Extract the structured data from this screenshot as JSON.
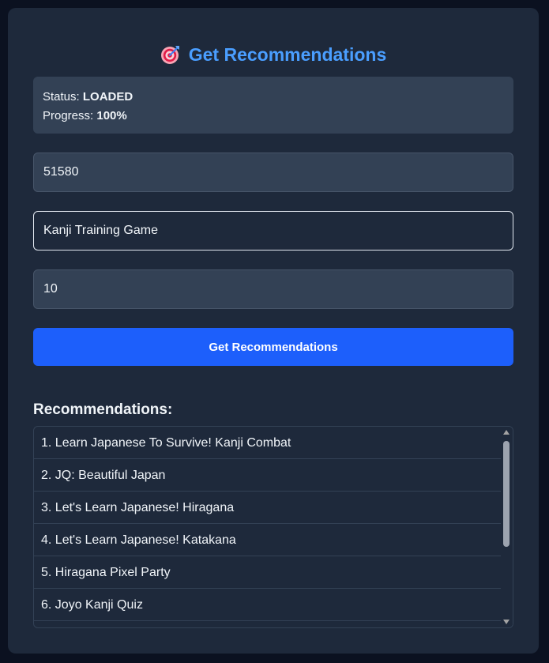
{
  "header": {
    "icon": "target-icon",
    "title": "Get Recommendations"
  },
  "status": {
    "status_label": "Status:",
    "status_value": "LOADED",
    "progress_label": "Progress:",
    "progress_value": "100%"
  },
  "form": {
    "app_id_value": "51580",
    "game_name_value": "Kanji Training Game",
    "count_value": "10",
    "submit_label": "Get Recommendations"
  },
  "recommendations": {
    "heading": "Recommendations:",
    "items": [
      "1. Learn Japanese To Survive! Kanji Combat",
      "2. JQ: Beautiful Japan",
      "3. Let's Learn Japanese! Hiragana",
      "4. Let's Learn Japanese! Katakana",
      "5. Hiragana Pixel Party",
      "6. Joyo Kanji Quiz",
      ""
    ]
  },
  "colors": {
    "page_background": "#0b1120",
    "card_background": "#1e293b",
    "accent_title": "#4a9eff",
    "button_blue": "#1d5ffb",
    "field_background": "#334155"
  }
}
